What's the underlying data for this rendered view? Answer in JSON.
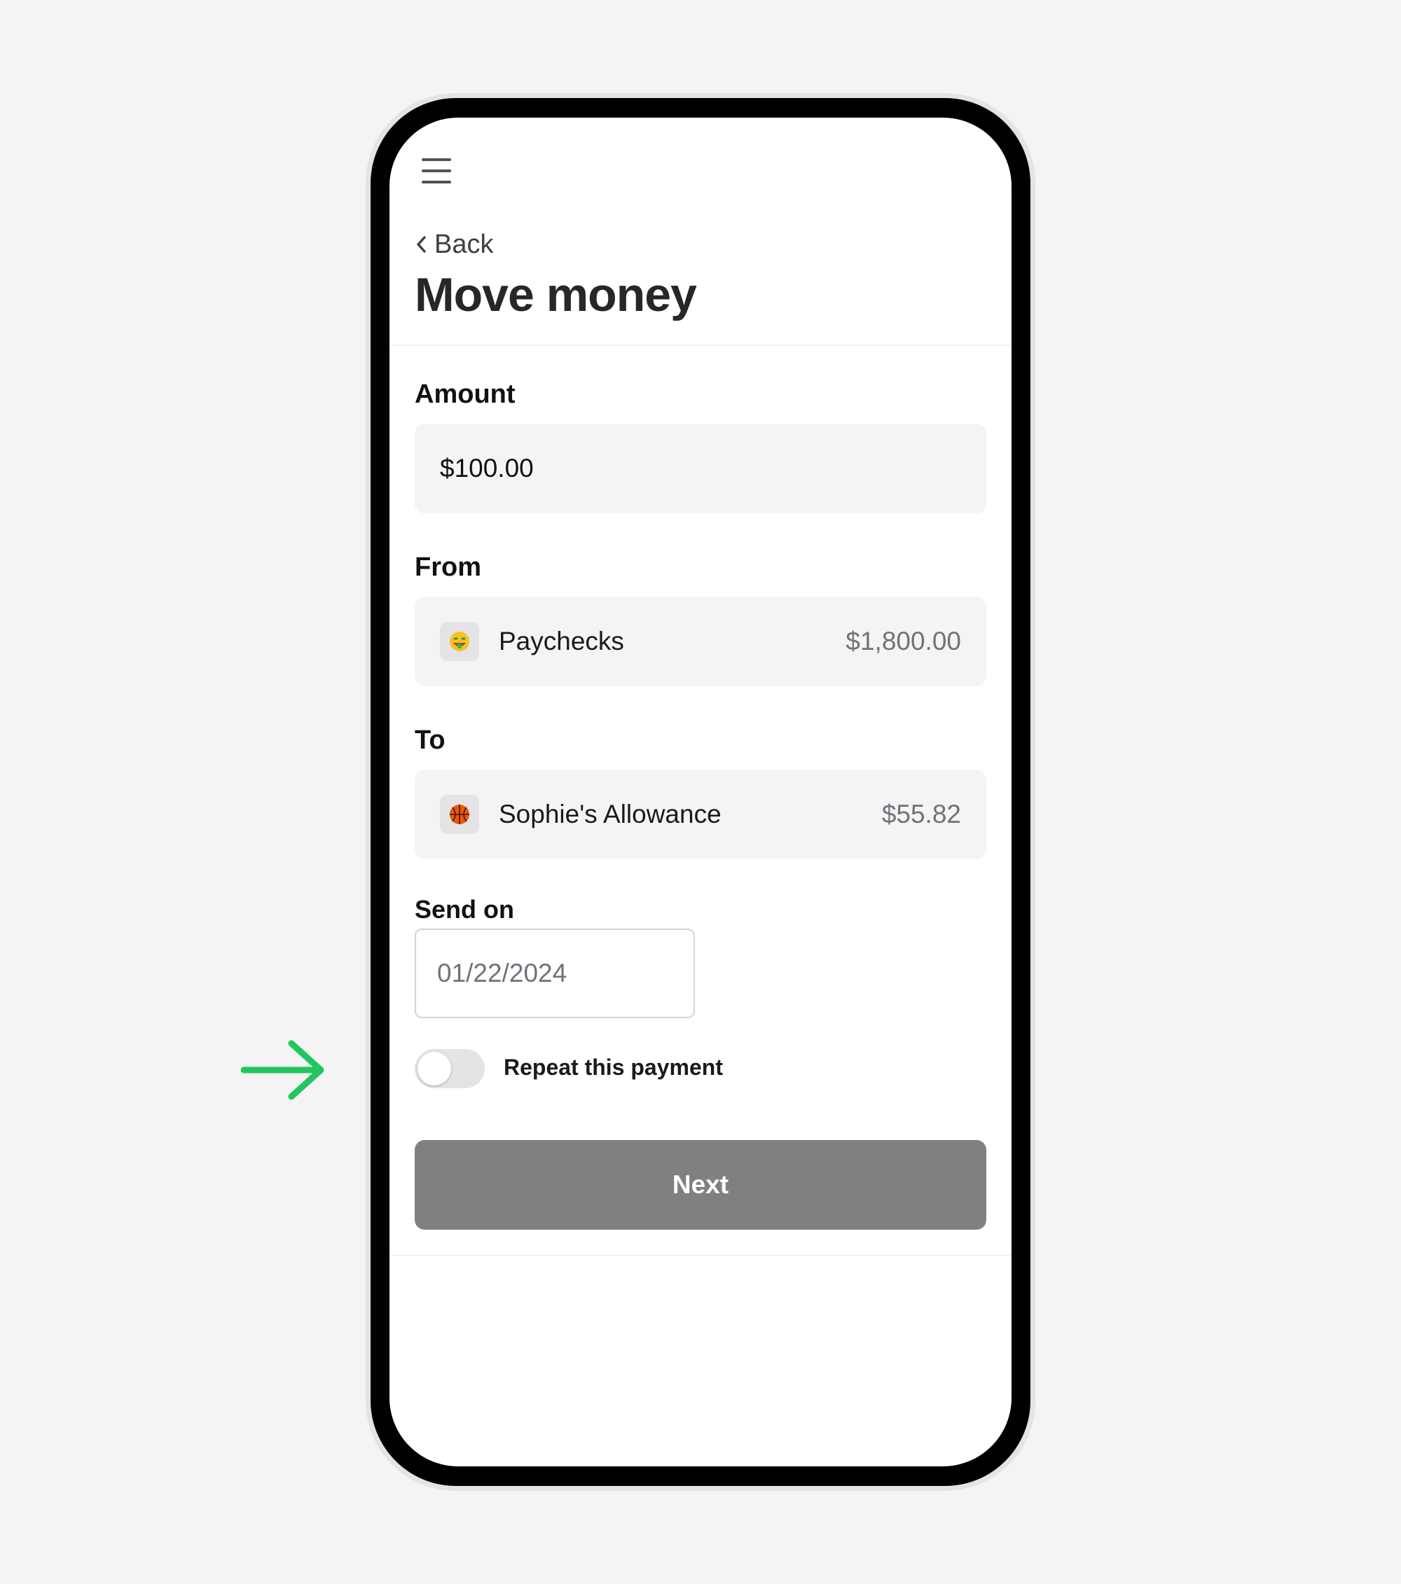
{
  "header": {
    "back_label": "Back",
    "title": "Move money"
  },
  "amount": {
    "label": "Amount",
    "value": "$100.00"
  },
  "from": {
    "label": "From",
    "account_name": "Paychecks",
    "balance": "$1,800.00",
    "emoji": "🤑"
  },
  "to": {
    "label": "To",
    "account_name": "Sophie's Allowance",
    "balance": "$55.82",
    "emoji": "🏀"
  },
  "send_on": {
    "label": "Send on",
    "date_value": "01/22/2024"
  },
  "repeat": {
    "label": "Repeat this payment",
    "enabled": false
  },
  "actions": {
    "next_label": "Next"
  },
  "colors": {
    "background": "#f4f4f5",
    "button_disabled": "#808080",
    "annotation_arrow": "#22c55e"
  }
}
